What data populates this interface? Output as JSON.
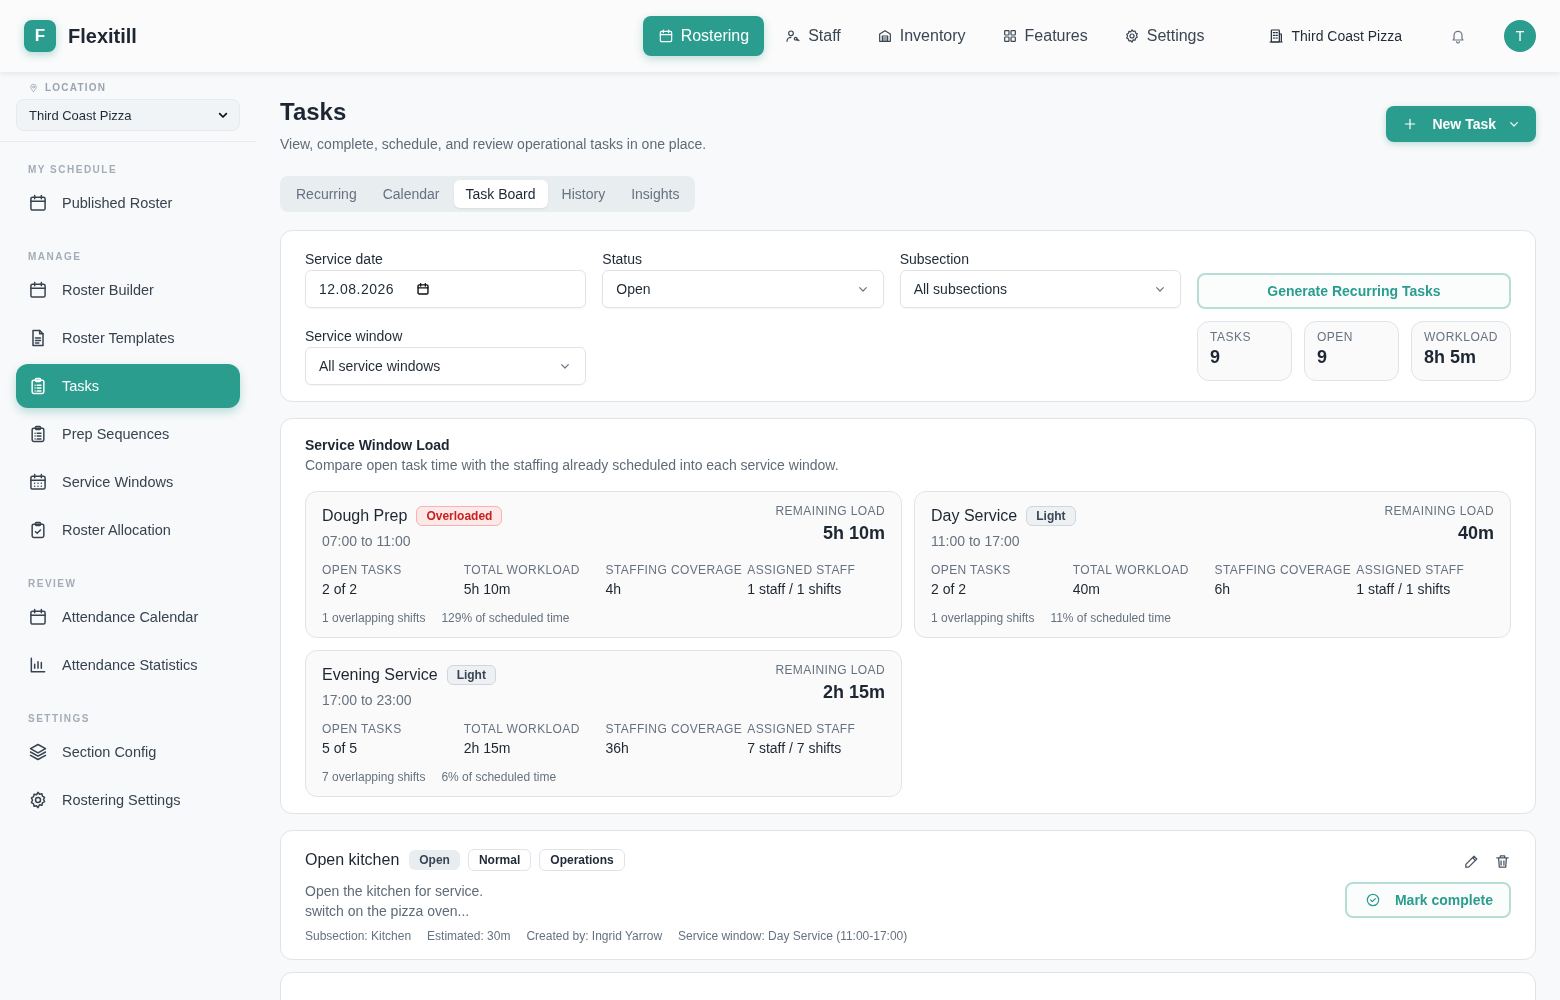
{
  "brand": {
    "letter": "F",
    "name": "Flexitill"
  },
  "nav": [
    {
      "label": "Rostering",
      "selected": true
    },
    {
      "label": "Staff",
      "selected": false
    },
    {
      "label": "Inventory",
      "selected": false
    },
    {
      "label": "Features",
      "selected": false
    },
    {
      "label": "Settings",
      "selected": false
    }
  ],
  "location_name": "Third Coast Pizza",
  "avatar": "T",
  "sidebar": {
    "location_label": "LOCATION",
    "location_value": "Third Coast Pizza",
    "sections": [
      {
        "title": "MY SCHEDULE",
        "items": [
          {
            "label": "Published Roster",
            "selected": false
          }
        ]
      },
      {
        "title": "MANAGE",
        "items": [
          {
            "label": "Roster Builder",
            "selected": false
          },
          {
            "label": "Roster Templates",
            "selected": false
          },
          {
            "label": "Tasks",
            "selected": true
          },
          {
            "label": "Prep Sequences",
            "selected": false
          },
          {
            "label": "Service Windows",
            "selected": false
          },
          {
            "label": "Roster Allocation",
            "selected": false
          }
        ]
      },
      {
        "title": "REVIEW",
        "items": [
          {
            "label": "Attendance Calendar",
            "selected": false
          },
          {
            "label": "Attendance Statistics",
            "selected": false
          }
        ]
      },
      {
        "title": "SETTINGS",
        "items": [
          {
            "label": "Section Config",
            "selected": false
          },
          {
            "label": "Rostering Settings",
            "selected": false
          }
        ]
      }
    ]
  },
  "page": {
    "title": "Tasks",
    "subtitle": "View, complete, schedule, and review operational tasks in one place.",
    "new_button": "New Task"
  },
  "tabs": [
    {
      "label": "Recurring",
      "selected": false
    },
    {
      "label": "Calendar",
      "selected": false
    },
    {
      "label": "Task Board",
      "selected": true
    },
    {
      "label": "History",
      "selected": false
    },
    {
      "label": "Insights",
      "selected": false
    }
  ],
  "filters": {
    "service_date": {
      "label": "Service date",
      "value": "12.08.2026"
    },
    "status": {
      "label": "Status",
      "value": "Open"
    },
    "subsection": {
      "label": "Subsection",
      "value": "All subsections"
    },
    "service_window": {
      "label": "Service window",
      "value": "All service windows"
    },
    "generate_button": "Generate Recurring Tasks",
    "stats": [
      {
        "label": "TASKS",
        "value": "9"
      },
      {
        "label": "OPEN",
        "value": "9"
      },
      {
        "label": "WORKLOAD",
        "value": "8h 5m"
      }
    ]
  },
  "load": {
    "title": "Service Window Load",
    "subtitle": "Compare open task time with the staffing already scheduled into each service window.",
    "windows": [
      {
        "name": "Dough Prep",
        "badge": {
          "label": "Overloaded",
          "kind": "overloaded"
        },
        "time": "07:00 to 11:00",
        "remaining_label": "REMAINING LOAD",
        "remaining": "5h 10m",
        "metrics": [
          {
            "label": "OPEN TASKS",
            "value": "2 of 2"
          },
          {
            "label": "TOTAL WORKLOAD",
            "value": "5h 10m"
          },
          {
            "label": "STAFFING COVERAGE",
            "value": "4h"
          },
          {
            "label": "ASSIGNED STAFF",
            "value": "1 staff / 1 shifts"
          }
        ],
        "notes": [
          "1 overlapping shifts",
          "129% of scheduled time"
        ]
      },
      {
        "name": "Day Service",
        "badge": {
          "label": "Light",
          "kind": "light"
        },
        "time": "11:00 to 17:00",
        "remaining_label": "REMAINING LOAD",
        "remaining": "40m",
        "metrics": [
          {
            "label": "OPEN TASKS",
            "value": "2 of 2"
          },
          {
            "label": "TOTAL WORKLOAD",
            "value": "40m"
          },
          {
            "label": "STAFFING COVERAGE",
            "value": "6h"
          },
          {
            "label": "ASSIGNED STAFF",
            "value": "1 staff / 1 shifts"
          }
        ],
        "notes": [
          "1 overlapping shifts",
          "11% of scheduled time"
        ]
      },
      {
        "name": "Evening Service",
        "badge": {
          "label": "Light",
          "kind": "light"
        },
        "time": "17:00 to 23:00",
        "remaining_label": "REMAINING LOAD",
        "remaining": "2h 15m",
        "metrics": [
          {
            "label": "OPEN TASKS",
            "value": "5 of 5"
          },
          {
            "label": "TOTAL WORKLOAD",
            "value": "2h 15m"
          },
          {
            "label": "STAFFING COVERAGE",
            "value": "36h"
          },
          {
            "label": "ASSIGNED STAFF",
            "value": "7 staff / 7 shifts"
          }
        ],
        "notes": [
          "7 overlapping shifts",
          "6% of scheduled time"
        ]
      }
    ]
  },
  "task": {
    "title": "Open kitchen",
    "tags": [
      {
        "label": "Open",
        "kind": "status"
      },
      {
        "label": "Normal",
        "kind": "outline"
      },
      {
        "label": "Operations",
        "kind": "outline"
      }
    ],
    "description": [
      "Open the kitchen for service.",
      "switch on the pizza oven..."
    ],
    "meta": [
      "Subsection: Kitchen",
      "Estimated: 30m",
      "Created by: Ingrid Yarrow",
      "Service window: Day Service (11:00-17:00)"
    ],
    "complete_button": "Mark complete"
  }
}
